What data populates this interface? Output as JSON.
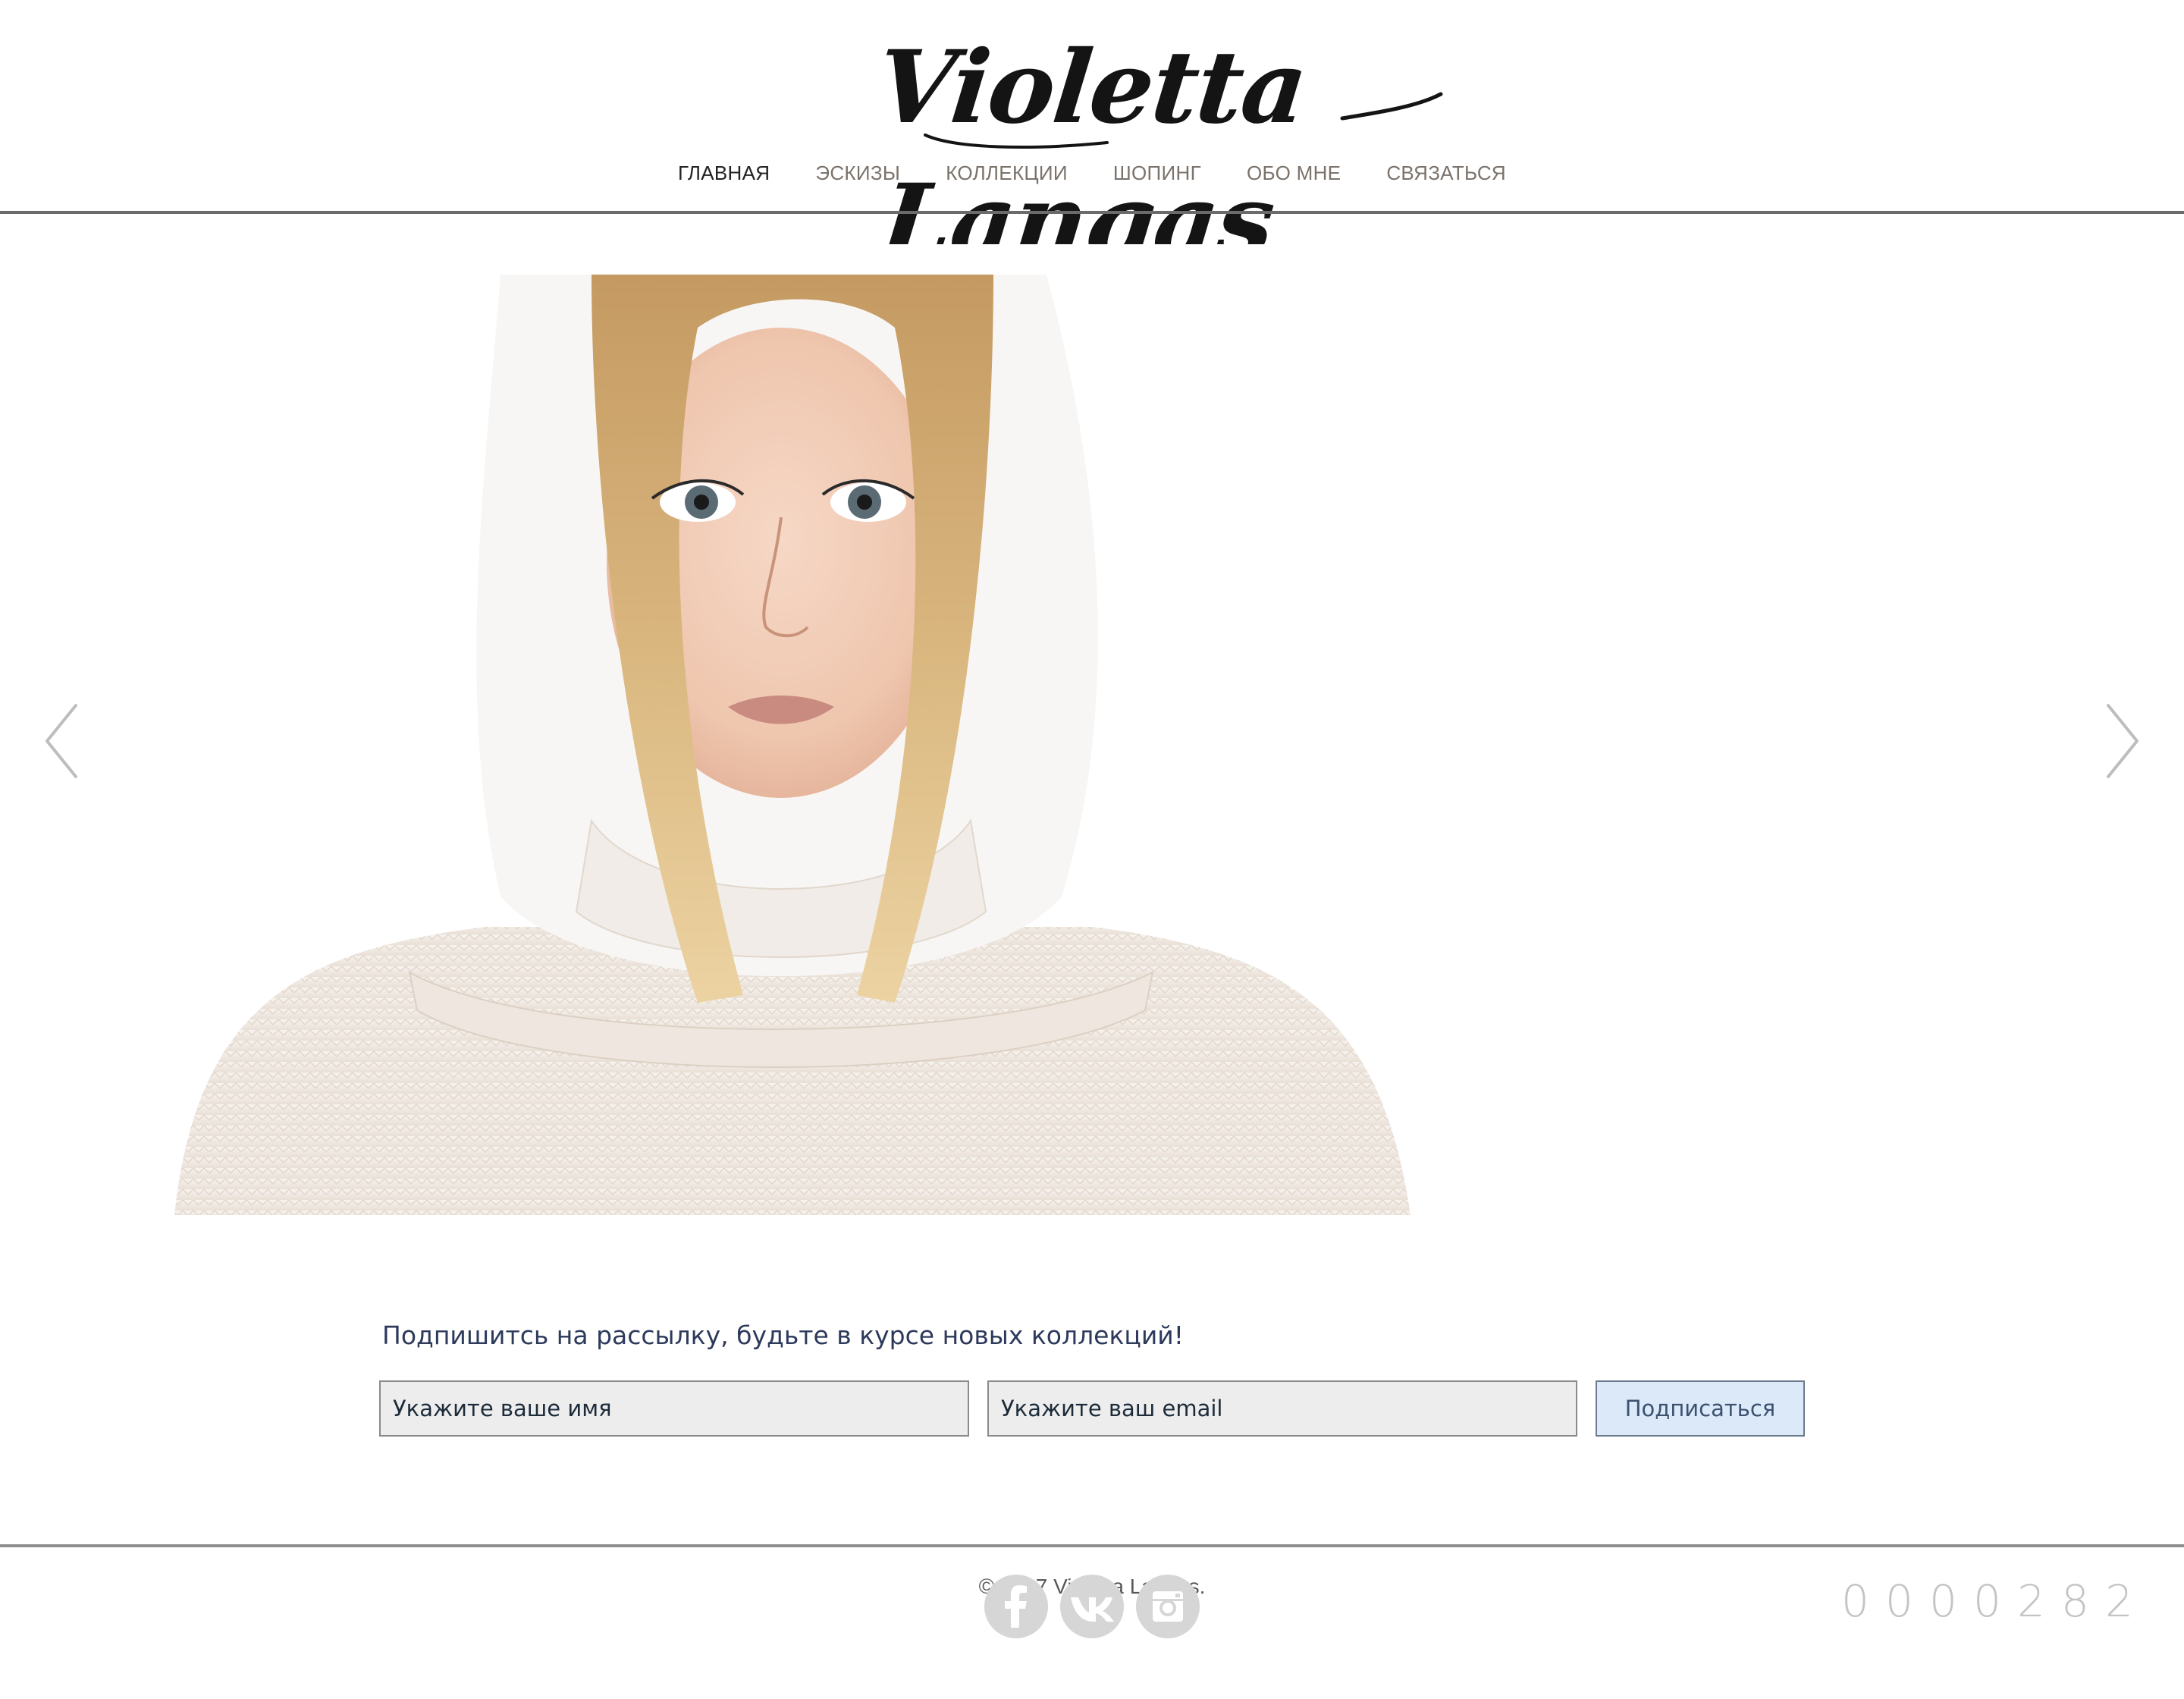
{
  "header": {
    "logo_text": "Violetta Langas",
    "nav": [
      {
        "label": "ГЛАВНАЯ",
        "active": true
      },
      {
        "label": "ЭСКИЗЫ",
        "active": false
      },
      {
        "label": "КОЛЛЕКЦИИ",
        "active": false
      },
      {
        "label": "ШОПИНГ",
        "active": false
      },
      {
        "label": "ОБО МНЕ",
        "active": false
      },
      {
        "label": "СВЯЗАТЬСЯ",
        "active": false
      }
    ]
  },
  "hero": {
    "prev_icon": "chevron-left-icon",
    "next_icon": "chevron-right-icon"
  },
  "subscribe": {
    "title": "Подпишитсь на рассылку, будьте в курсе новых коллекций!",
    "name_placeholder": "Укажите ваше имя",
    "email_placeholder": "Укажите ваш email",
    "button_label": "Подписаться",
    "button_color": "#dbe9f8",
    "title_color": "#2d3a5c"
  },
  "footer": {
    "copyright": "© 2017 Violetta Langas.",
    "socials": [
      {
        "icon": "facebook-icon"
      },
      {
        "icon": "vk-icon"
      },
      {
        "icon": "instagram-icon"
      }
    ],
    "counter_digits": [
      "0",
      "0",
      "0",
      "0",
      "2",
      "8",
      "2"
    ]
  }
}
